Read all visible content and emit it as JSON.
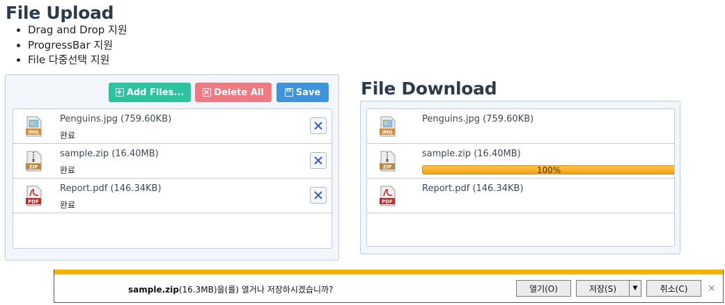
{
  "upload": {
    "title": "File Upload",
    "features": [
      "Drag and Drop 지원",
      "ProgressBar 지원",
      "File 다중선택 지원"
    ],
    "buttons": {
      "add": "Add Files...",
      "delete_all": "Delete All",
      "save": "Save"
    },
    "files": [
      {
        "type": "IMG",
        "name": "Penguins.jpg (759.60KB)",
        "status": "완료"
      },
      {
        "type": "ZIP",
        "name": "sample.zip (16.40MB)",
        "status": "완료"
      },
      {
        "type": "PDF",
        "name": "Report.pdf (146.34KB)",
        "status": "완료"
      }
    ]
  },
  "download": {
    "title": "File Download",
    "files": [
      {
        "type": "IMG",
        "name": "Penguins.jpg (759.60KB)"
      },
      {
        "type": "ZIP",
        "name": "sample.zip (16.40MB)",
        "progress_label": "100%",
        "progress": 100
      },
      {
        "type": "PDF",
        "name": "Report.pdf (146.34KB)"
      }
    ]
  },
  "notification": {
    "filename": "sample.zip",
    "message_rest": "(16.3MB)을(를) 열거나 저장하시겠습니까?",
    "open": "열기(O)",
    "save": "저장(S)",
    "dropdown": "▼",
    "cancel": "취소(C)",
    "close": "×"
  },
  "icons": {
    "file_types": [
      "image-file-icon",
      "zip-file-icon",
      "pdf-file-icon"
    ],
    "remove": "close-icon"
  },
  "colors": {
    "add": "#2cc39f",
    "delete": "#ef7a82",
    "save": "#3d94dd",
    "progress": "#f3a20f",
    "notify": "#f2b400"
  }
}
